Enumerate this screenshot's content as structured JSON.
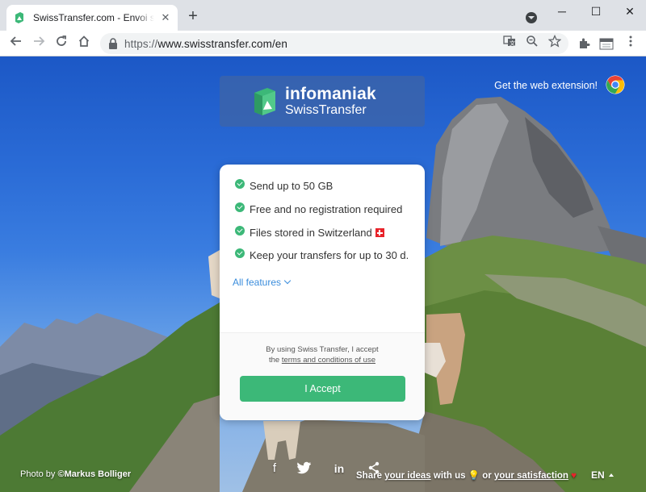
{
  "browser": {
    "tab_title": "SwissTransfer.com - Envoi sécurisé",
    "url_protocol": "https://",
    "url_host": "www.swisstransfer.com/en",
    "new_tab_label": "+",
    "window": {
      "minimize": "─",
      "maximize": "☐",
      "close": "✕"
    }
  },
  "header": {
    "brand": "infomaniak",
    "product": "SwissTransfer",
    "extension_link": "Get the web extension!"
  },
  "features": [
    {
      "label": "Send up to 50 GB"
    },
    {
      "label": "Free and no registration required"
    },
    {
      "label": "Files stored in Switzerland"
    },
    {
      "label": "Keep your transfers for up to 30 d."
    }
  ],
  "all_features_label": "All features",
  "consent": {
    "line1": "By using Swiss Transfer, I accept",
    "line2_prefix": "the ",
    "terms_link": "terms and conditions of use",
    "accept_button": "I Accept"
  },
  "footer": {
    "photo_by": "Photo by ",
    "photographer": "©Markus Bolliger",
    "share_prefix": "Share ",
    "your_ideas": "your ideas",
    "with_us": " with us ",
    "or": " or ",
    "your_satisfaction": "your satisfaction",
    "language": "EN"
  },
  "icons": {
    "facebook": "f",
    "twitter": "🐦",
    "linkedin": "in",
    "share": "⋖"
  },
  "colors": {
    "accent_green": "#3cb878",
    "link_blue": "#3b8ddc",
    "logo_box": "#3c64aa"
  }
}
